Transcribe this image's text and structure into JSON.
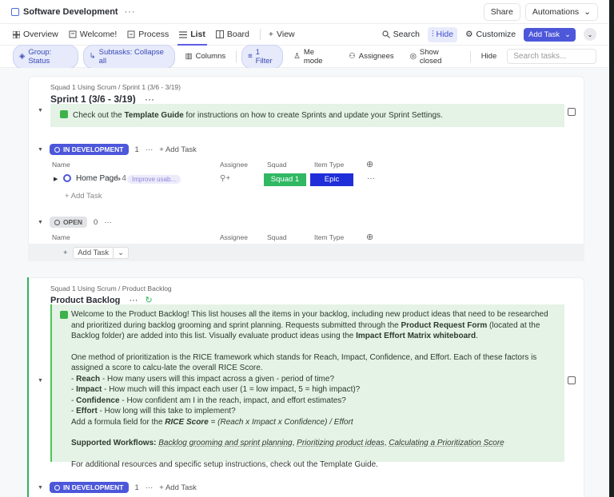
{
  "topbar": {
    "title": "Software Development",
    "more": "···",
    "share": "Share",
    "automations": "Automations",
    "chevron": "⌄"
  },
  "views": {
    "tabs": [
      {
        "label": "Overview",
        "icon": "grid-icon"
      },
      {
        "label": "Welcome!",
        "icon": "welcome-icon"
      },
      {
        "label": "Process",
        "icon": "process-icon"
      },
      {
        "label": "List",
        "icon": "list-icon",
        "active": true
      },
      {
        "label": "Board",
        "icon": "board-icon"
      },
      {
        "label": "View",
        "icon": "plus-icon"
      }
    ],
    "search": "Search",
    "hide": "Hide",
    "customize": "Customize",
    "add_task": "Add Task"
  },
  "filters": {
    "group": "Group: Status",
    "subtasks": "Subtasks: Collapse all",
    "columns": "Columns",
    "filter": "1 Filter",
    "me_mode": "Me mode",
    "assignees": "Assignees",
    "show_closed": "Show closed",
    "hide": "Hide",
    "search_placeholder": "Search tasks..."
  },
  "sprint": {
    "crumb": "Squad 1 Using Scrum / Sprint 1 (3/6 - 3/19)",
    "title": "Sprint 1 (3/6 - 3/19)",
    "more": "···",
    "notice_pre": "Check out the ",
    "notice_bold": "Template Guide",
    "notice_post": " for instructions on how to create Sprints and update your Sprint Settings.",
    "group1": {
      "status": "IN DEVELOPMENT",
      "count": "1",
      "more": "···",
      "add": "+ Add Task",
      "columns": [
        "Name",
        "Assignee",
        "Squad",
        "Item Type"
      ],
      "task": {
        "name": "Home Page",
        "subtasks": "4",
        "tag": "Improve usab...",
        "squad": "Squad 1",
        "item_type": "Epic",
        "more": "···"
      },
      "add_task": "+ Add Task"
    },
    "group2": {
      "status": "OPEN",
      "count": "0",
      "more": "···",
      "columns": [
        "Name",
        "Assignee",
        "Squad",
        "Item Type"
      ],
      "add_task": "Add Task"
    }
  },
  "backlog": {
    "crumb": "Squad 1 Using Scrum / Product Backlog",
    "title": "Product Backlog",
    "more": "···",
    "p1a": "Welcome to the Product Backlog! This list houses all the items in your backlog, including new product ideas that need to be researched and prioritized during backlog grooming and sprint planning. Requests submitted through the ",
    "p1b": "Product Request Form",
    "p1c": " (located at the Backlog folder) are added into this list. Visually evaluate product ideas using the ",
    "p1d": "Impact Effort Matrix whiteboard",
    "p1e": ".",
    "p2": "One method of prioritization is the RICE framework which stands for Reach, Impact, Confidence, and Effort. Each of these factors is assigned a score to calcu-late the overall RICE Score.",
    "reach_b": "Reach",
    "reach_t": " - How many users will this impact across a given - period of time?",
    "impact_b": "Impact",
    "impact_t": " - How much will this impact each user (1 = low impact, 5 = high impact)?",
    "conf_b": "Confidence",
    "conf_t": " - How confident am I in the reach, impact, and effort estimates?",
    "effort_b": "Effort",
    "effort_t": " - How long will this take to implement?",
    "formula_a": "Add a formula field for the ",
    "formula_b": "RICE Score",
    "formula_c": " = (Reach x Impact x Confidence) / Effort",
    "wf_label": "Supported Workflows:",
    "wf_1": "Backlog grooming and sprint planning",
    "wf_2": "Prioritizing product ideas",
    "wf_3": "Calculating a Prioritization Score",
    "footer": "For additional resources and specific setup instructions, check out the Template Guide.",
    "group": {
      "status": "IN DEVELOPMENT",
      "count": "1",
      "more": "···",
      "add": "+ Add Task"
    }
  },
  "colors": {
    "accent": "#4c57d9",
    "squad": "#30b863",
    "epic": "#1f2ed8",
    "notice_bg": "#e5f2e6"
  }
}
